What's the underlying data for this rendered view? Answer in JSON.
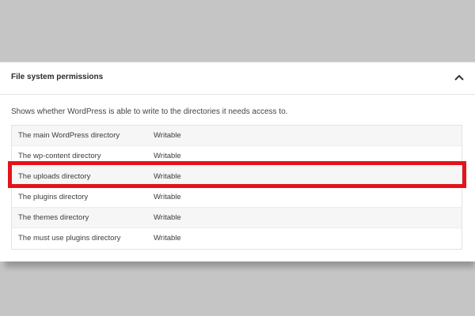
{
  "panel": {
    "title": "File system permissions",
    "collapse_icon": "chevron-up-icon",
    "description": "Shows whether WordPress is able to write to the directories it needs access to."
  },
  "rows": [
    {
      "name": "The main WordPress directory",
      "status": "Writable"
    },
    {
      "name": "The wp-content directory",
      "status": "Writable"
    },
    {
      "name": "The uploads directory",
      "status": "Writable"
    },
    {
      "name": "The plugins directory",
      "status": "Writable"
    },
    {
      "name": "The themes directory",
      "status": "Writable"
    },
    {
      "name": "The must use plugins directory",
      "status": "Writable"
    }
  ],
  "highlight": {
    "color": "#e3131b",
    "row": "The uploads directory"
  }
}
